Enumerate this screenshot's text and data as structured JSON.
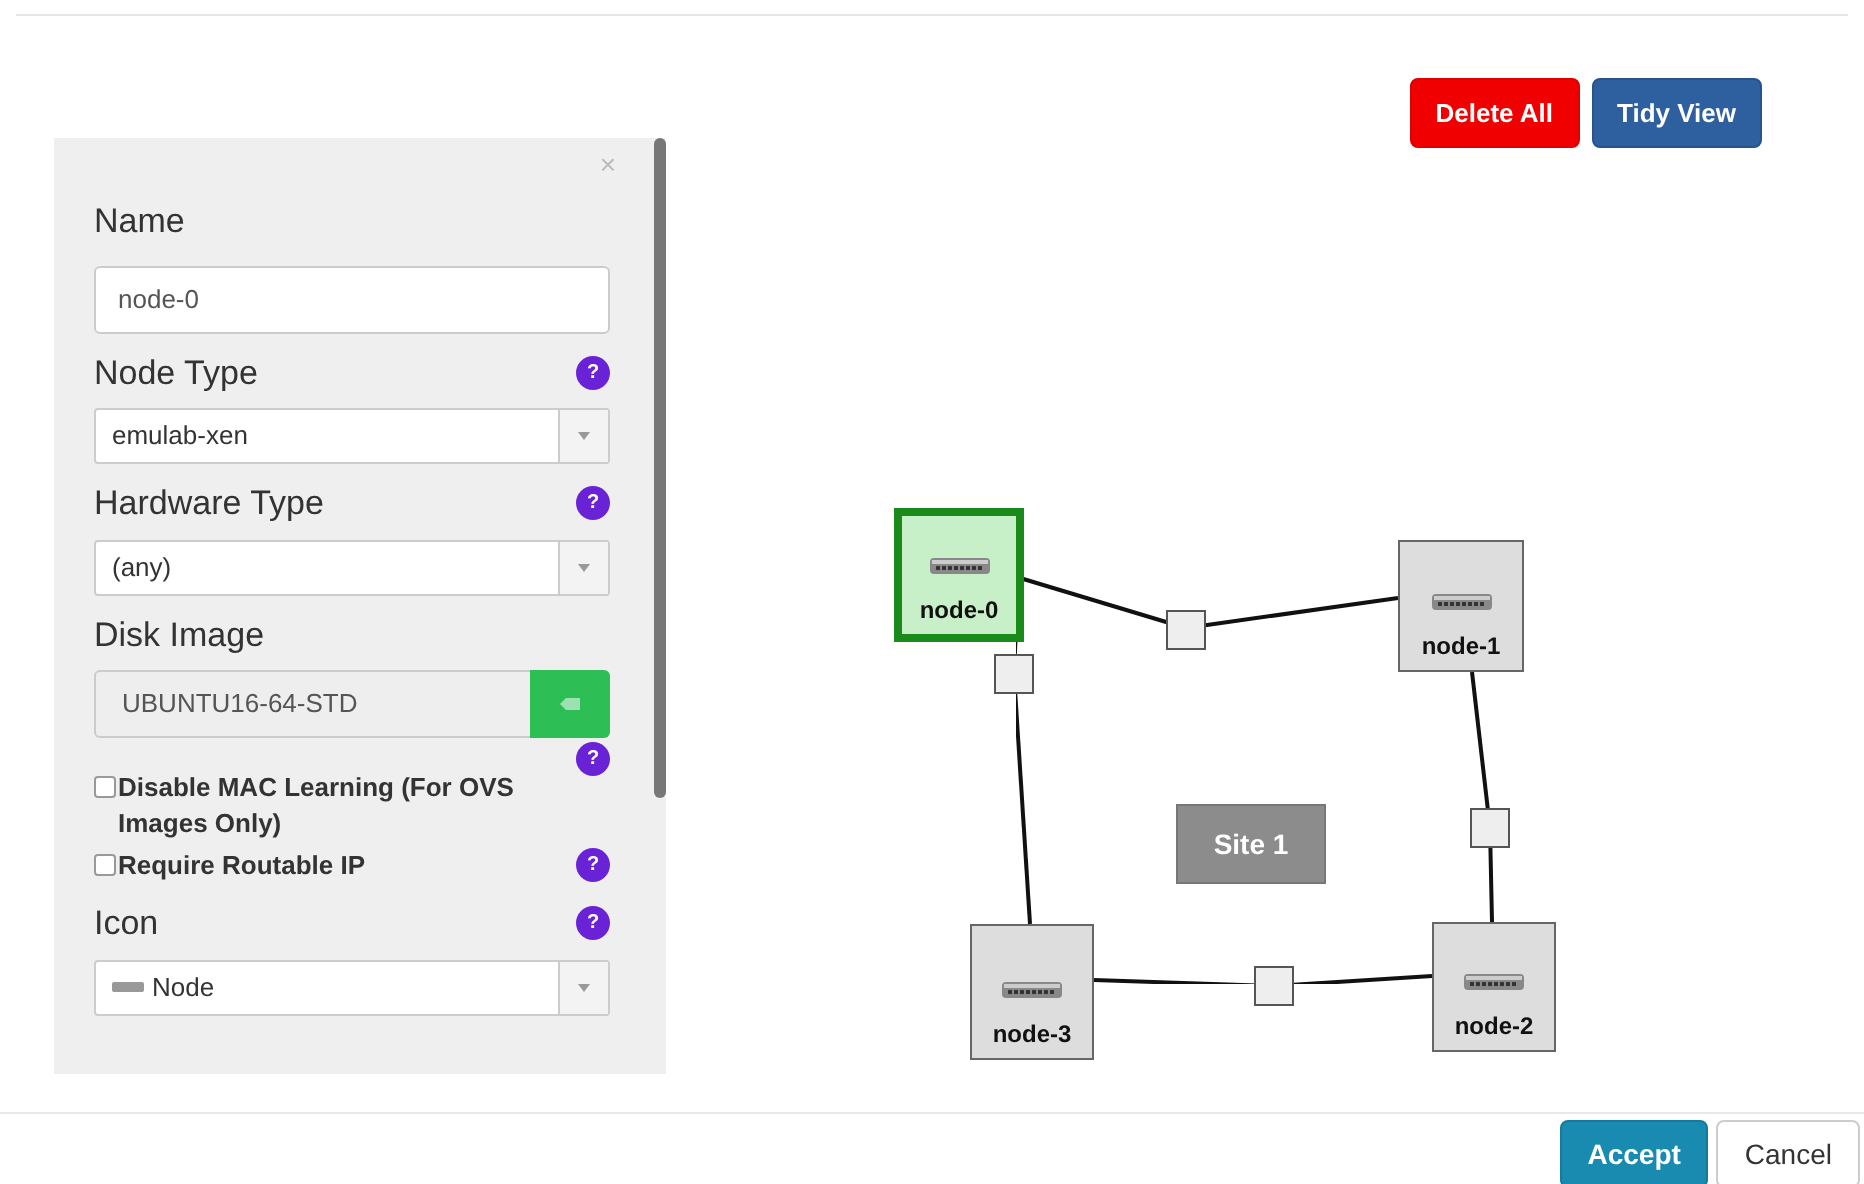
{
  "toolbar": {
    "buttons": [
      {
        "label": "Delete All",
        "kind": "danger"
      },
      {
        "label": "Tidy View",
        "kind": "primary"
      }
    ]
  },
  "panel": {
    "close": "×",
    "fields": [
      {
        "kind": "text",
        "label": "Name",
        "value": "node-0"
      },
      {
        "kind": "select",
        "label": "Node Type",
        "value": "emulab-xen",
        "help": "?"
      },
      {
        "kind": "select",
        "label": "Hardware Type",
        "value": "(any)",
        "help": "?"
      },
      {
        "kind": "image",
        "label": "Disk Image",
        "value": "UBUNTU16-64-STD",
        "help": "?"
      },
      {
        "kind": "checkbox",
        "label": "Disable MAC Learning (For OVS Images Only)",
        "checked": false
      },
      {
        "kind": "checkbox",
        "label": "Require Routable IP",
        "checked": false,
        "help": "?"
      },
      {
        "kind": "icon",
        "label": "Icon",
        "value": "Node",
        "help": "?"
      }
    ]
  },
  "canvas": {
    "site": "Site 1",
    "nodes": [
      {
        "name": "node-0",
        "selected": true
      },
      {
        "name": "node-1",
        "selected": false
      },
      {
        "name": "node-2",
        "selected": false
      },
      {
        "name": "node-3",
        "selected": false
      }
    ]
  },
  "footer": {
    "buttons": [
      {
        "label": "Accept",
        "kind": "primary"
      },
      {
        "label": "Cancel",
        "kind": "default"
      }
    ]
  }
}
